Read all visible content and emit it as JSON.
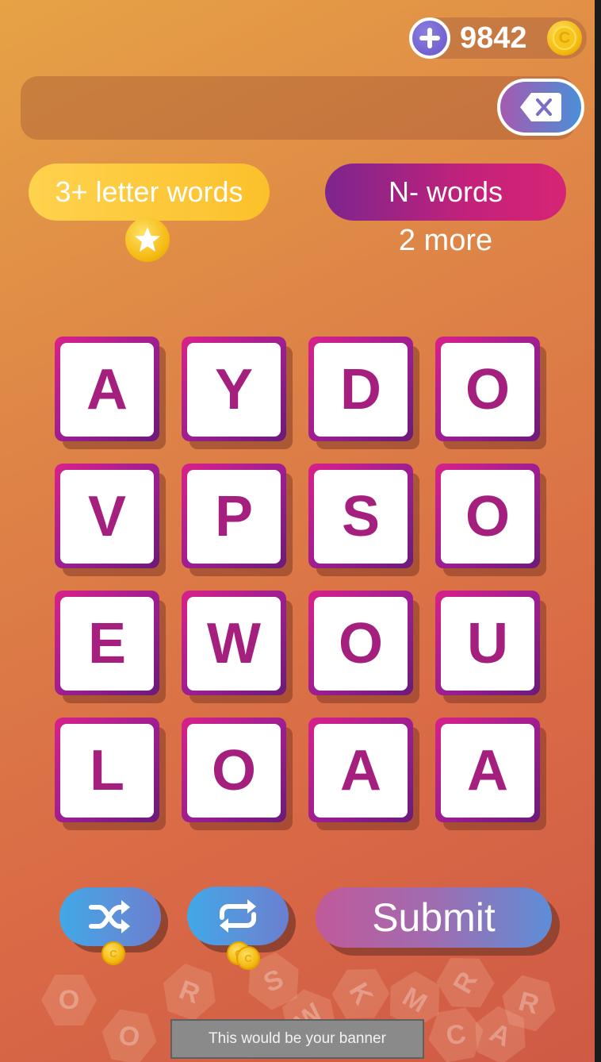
{
  "coins": {
    "count": "9842",
    "coin_symbol": "C"
  },
  "word_field": {
    "value": ""
  },
  "goals": {
    "letters_label": "3+ letter words",
    "nwords_label": "N- words",
    "nwords_remaining": "2 more"
  },
  "board": {
    "rows": [
      [
        "A",
        "Y",
        "D",
        "O"
      ],
      [
        "V",
        "P",
        "S",
        "O"
      ],
      [
        "E",
        "W",
        "O",
        "U"
      ],
      [
        "L",
        "O",
        "A",
        "A"
      ]
    ]
  },
  "controls": {
    "submit_label": "Submit",
    "shuffle_cost_icon": "coin-icon",
    "rotate_cost_icon": "coins-icon"
  },
  "background_tiles": [
    "O",
    "R",
    "S",
    "K",
    "W",
    "M",
    "R",
    "R",
    "C",
    "A",
    "O"
  ],
  "banner": {
    "text": "This would be your banner"
  },
  "colors": {
    "accent_magenta": "#a51f7f",
    "gold": "#fbc12b",
    "blue": "#40a8e8"
  }
}
